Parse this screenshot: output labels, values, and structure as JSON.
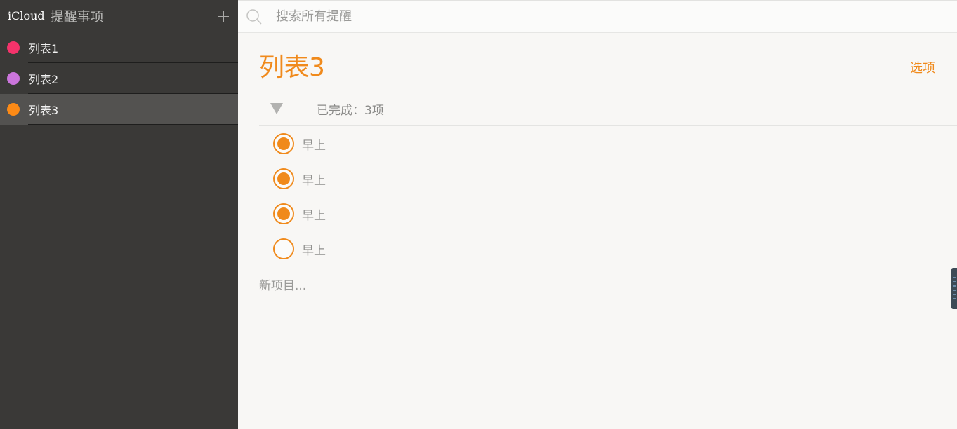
{
  "sidebar": {
    "brand": "iCloud",
    "app_title": "提醒事项",
    "add_icon": "plus-icon",
    "items": [
      {
        "label": "列表1",
        "color": "#f4336b",
        "selected": false
      },
      {
        "label": "列表2",
        "color": "#cb75dc",
        "selected": false
      },
      {
        "label": "列表3",
        "color": "#fc8a16",
        "selected": true
      }
    ]
  },
  "search": {
    "placeholder": "搜索所有提醒",
    "icon": "search-icon"
  },
  "main": {
    "title": "列表3",
    "options_label": "选项",
    "completed_label": "已完成：3项",
    "todos": [
      {
        "text": "早上",
        "done": true
      },
      {
        "text": "早上",
        "done": true
      },
      {
        "text": "早上",
        "done": true
      },
      {
        "text": "早上",
        "done": false
      }
    ],
    "new_item_placeholder": "新项目..."
  },
  "colors": {
    "accent": "#f08a1c",
    "sidebar_bg": "#3a3937",
    "sidebar_selected": "#535250"
  }
}
